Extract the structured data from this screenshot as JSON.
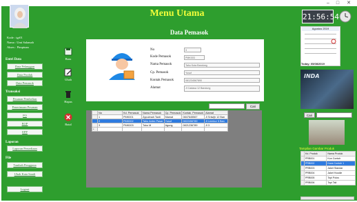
{
  "window": {
    "minimize": "–",
    "maximize": "□",
    "close": "✕"
  },
  "user": {
    "kode_label": "Kode",
    "kode_value": ": tgr01",
    "nama_label": "Nama",
    "nama_value": ": Umi Salamah",
    "akses_label": "Akses",
    "akses_value": ": Pimpinan"
  },
  "sidebar": {
    "master_head": "Entri Data",
    "master_items": [
      "Data Pelanggan",
      "Data Produk",
      "Data Pemasok"
    ],
    "trans_head": "Transaksi",
    "trans_items": [
      "Pesanan Pembelian",
      "Penerimaan Pesanan",
      "PO",
      "BOP",
      "EPP"
    ],
    "report_head": "Laporan",
    "report_items": [
      "Laporan Persediaan"
    ],
    "file_head": "File",
    "file_items": [
      "Tambah Pengguna",
      "Ubah Kata Sandi"
    ],
    "logout": "Logout"
  },
  "header": {
    "title": "Menu Utama",
    "subtitle": "Data Pemasok"
  },
  "toolbar": {
    "baru": "Baru",
    "ubah": "Ubah",
    "hapus": "Hapus",
    "batal": "Batal"
  },
  "form": {
    "no_label": "No",
    "no_value": "3",
    "kode_label": "Kode Pemasok",
    "kode_value": "PMK003",
    "nama_label": "Nama Pemasok",
    "nama_value": "Tahu Kuta Bandung",
    "cp_label": "Cp. Pemasok",
    "cp_value": "Yusuf",
    "kontak_label": "Kontak Pemasok",
    "kontak_value": "081234567890",
    "alamat_label": "Alamat",
    "alamat_value": "Jl Cadasa 12 Bandung"
  },
  "search": {
    "button": "Cari"
  },
  "grid": {
    "columns": [
      "No",
      "Kd. Pemasok",
      "Nama Pemasok",
      "Cp. Pemasok",
      "Kontak. Pemasok",
      "Alamat"
    ],
    "rows": [
      [
        "1",
        "PMK001",
        "Zppulmah Tanti",
        "Mamat",
        "0847645567",
        "Jl Sriwijh 12 Ban"
      ],
      [
        "2",
        "PMK002",
        "Tahu Adiex Pasar",
        "Yusuf",
        "0822456789",
        "Jl Lembur 5 Ban"
      ],
      [
        "3",
        "PMK003",
        "Toko M",
        "Agung",
        "0821236789",
        "Jl 3"
      ]
    ],
    "new_row_marker": "*"
  },
  "right": {
    "clock": "21:56:54",
    "calendar_month": "Agustus 2019",
    "today": "Today: 05/08/2019",
    "car_label": "INDA",
    "cari_button": "Cari",
    "caption": "Tampilan Gambar Produk",
    "columns": [
      "Kd. Produk",
      "Nama Produk"
    ],
    "rows": [
      [
        "PRB001",
        "Kon Contoh"
      ],
      [
        "PRB002",
        "Kaos Contoh 1"
      ],
      [
        "PRB003",
        "Jaket Standar"
      ],
      [
        "PRB004",
        "Jaket Hoodie"
      ],
      [
        "PRB005",
        "Topi Polos"
      ],
      [
        "PRB006",
        "Topi Tali"
      ]
    ]
  },
  "colors": {
    "green": "#2e9e2e",
    "yellow": "#f2ff3a",
    "select_blue": "#2f7be0"
  }
}
